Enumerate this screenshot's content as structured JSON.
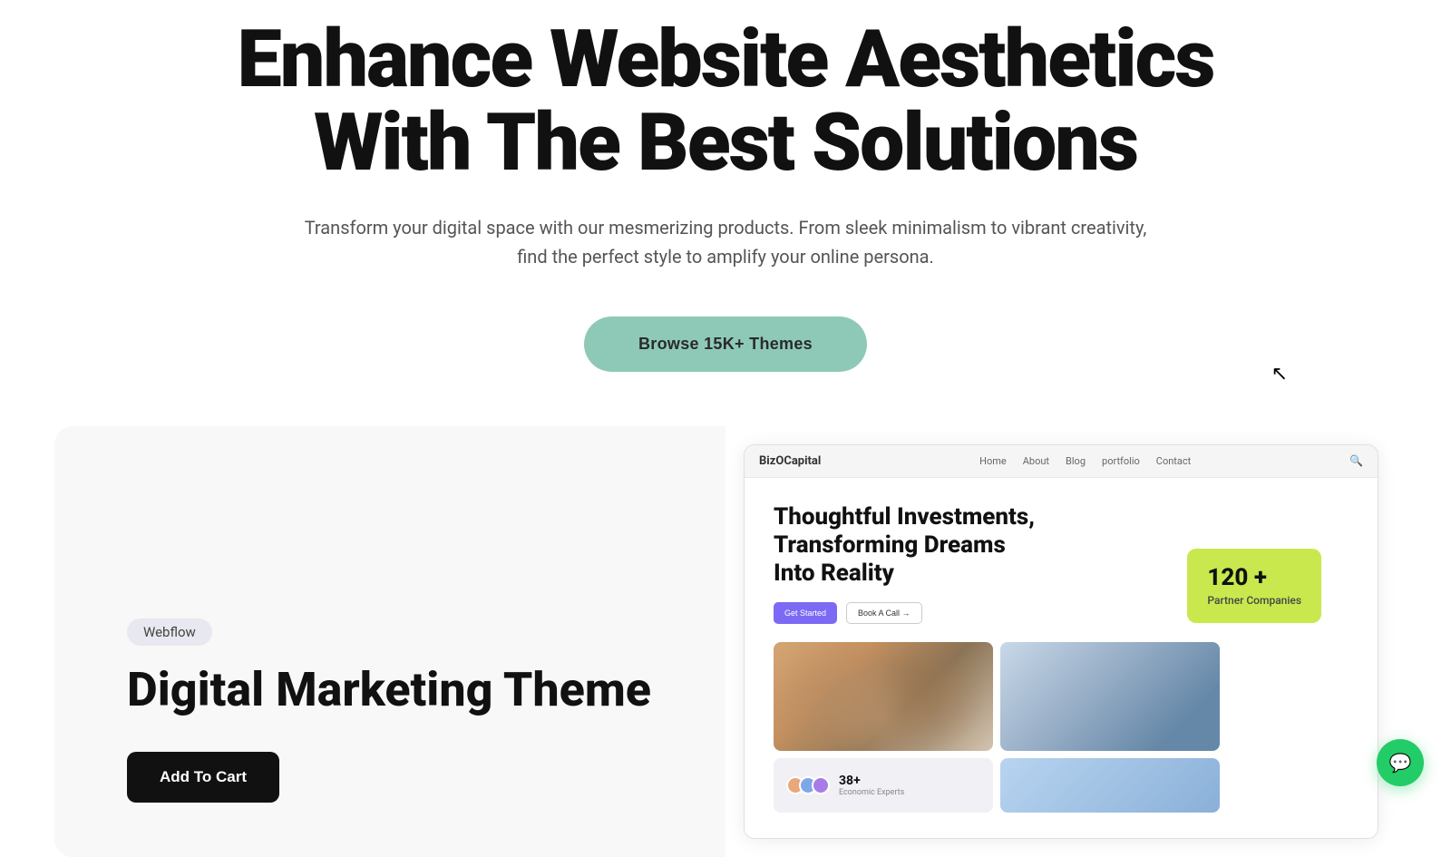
{
  "hero": {
    "title_line1": "Enhance Website Aesthetics",
    "title_line2": "With The Best Solutions",
    "subtitle": "Transform your digital space with our mesmerizing products. From sleek minimalism to vibrant creativity, find the perfect style to amplify your online persona.",
    "browse_button": "Browse 15K+ Themes"
  },
  "product_card": {
    "badge": "Webflow",
    "theme_title": "Digital Marketing Theme",
    "add_to_cart": "Add To Cart"
  },
  "preview": {
    "brand": "BizOCapital",
    "nav_items": [
      "Home",
      "About",
      "Blog",
      "Portfolio",
      "Contact"
    ],
    "headline_line1": "Thoughtful Investments,",
    "headline_line2": "Transforming Dreams",
    "headline_line3": "Into Reality",
    "btn_primary": "Get Started",
    "btn_secondary": "Book A Call →",
    "stat_number": "120 +",
    "stat_label": "Partner Companies",
    "bottom_stat_number": "38+",
    "bottom_stat_label": "Economic Experts"
  },
  "chat": {
    "icon": "💬"
  },
  "colors": {
    "accent_green": "#8ec9b8",
    "stat_yellow": "#c8e84e",
    "dark": "#111111",
    "badge_bg": "#e8e8f0"
  }
}
